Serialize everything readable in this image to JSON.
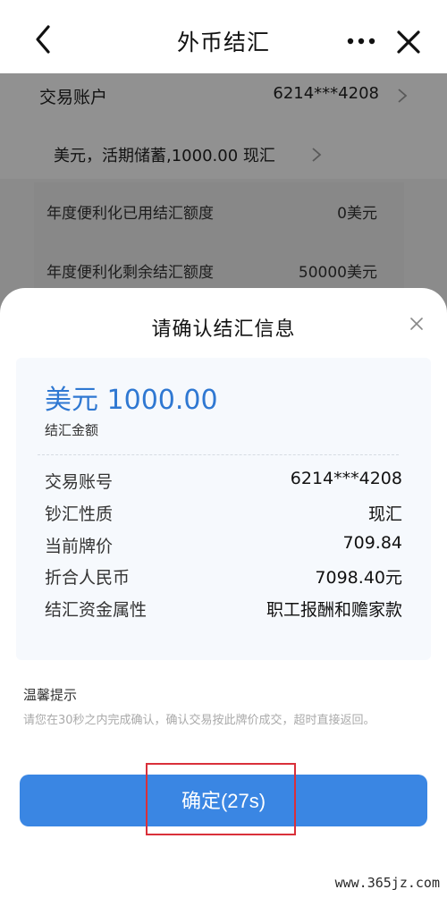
{
  "nav": {
    "title": "外币结汇",
    "back_icon": "chevron-left-icon",
    "more_icon": "more-dots-icon",
    "close_icon": "close-icon"
  },
  "background_page": {
    "account_label": "交易账户",
    "account_value": "6214***4208",
    "currency_row": "美元，活期储蓄,1000.00 现汇",
    "quota": [
      {
        "label": "年度便利化已用结汇额度",
        "value": "0美元"
      },
      {
        "label": "年度便利化剩余结汇额度",
        "value": "50000美元"
      }
    ]
  },
  "sheet": {
    "title": "请确认结汇信息",
    "amount": "美元 1000.00",
    "amount_label": "结汇金额",
    "details": [
      {
        "label": "交易账号",
        "value": "6214***4208"
      },
      {
        "label": "钞汇性质",
        "value": "现汇"
      },
      {
        "label": "当前牌价",
        "value": "709.84"
      },
      {
        "label": "折合人民币",
        "value": "7098.40元"
      },
      {
        "label": "结汇资金属性",
        "value": "职工报酬和赡家款"
      }
    ],
    "tips_title": "温馨提示",
    "tips_text": "请您在30秒之内完成确认，确认交易按此牌价成交，超时直接返回。",
    "confirm_label": "确定(27s)"
  },
  "watermark": "www.365jz.com",
  "colors": {
    "accent": "#3a86e3",
    "amount_blue": "#2f78d2",
    "highlight_red": "#d9303a"
  }
}
